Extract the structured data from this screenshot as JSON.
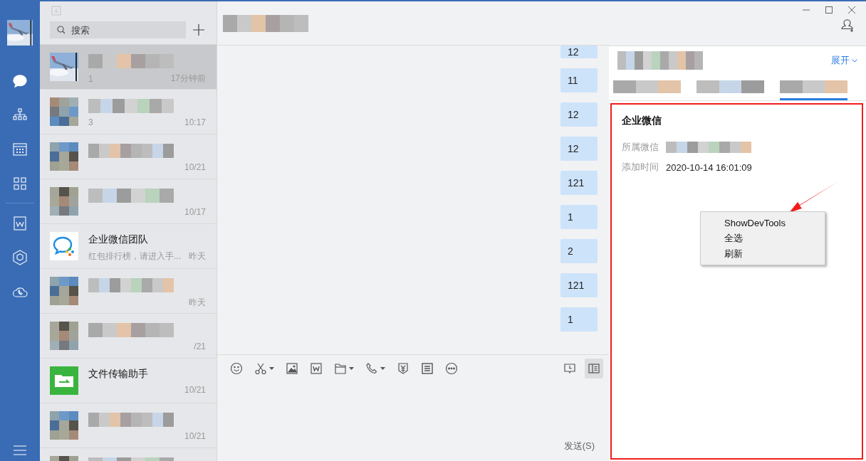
{
  "sidebar": {
    "nav_items": [
      {
        "kind": "chat",
        "selected": true
      },
      {
        "kind": "org",
        "selected": false
      },
      {
        "kind": "calendar",
        "selected": false
      },
      {
        "kind": "apps",
        "selected": false
      },
      {
        "kind": "doc",
        "selected": false
      },
      {
        "kind": "cube",
        "selected": false
      },
      {
        "kind": "cloud",
        "selected": false
      }
    ]
  },
  "chat_list": {
    "search": {
      "placeholder": "搜索"
    },
    "chats": [
      {
        "preview": "1",
        "time": "17分钟前",
        "selected": true
      },
      {
        "kind": "mosaic",
        "preview": "3",
        "time": "10:17",
        "selected": false
      },
      {
        "kind": "mosaic",
        "time": "10/21",
        "selected": false
      },
      {
        "kind": "mosaic",
        "time": "10/17",
        "selected": false
      },
      {
        "kind": "wecom",
        "name": "企业微信团队",
        "preview": "红包排行榜，请进入手...",
        "time": "昨天",
        "selected": false
      },
      {
        "kind": "mosaic",
        "time": "昨天",
        "selected": false
      },
      {
        "kind": "mosaic",
        "time": "/21",
        "selected": false
      },
      {
        "kind": "file",
        "name": "文件传输助手",
        "time": "10/21",
        "selected": false
      },
      {
        "kind": "mosaic",
        "time": "10/21",
        "selected": false
      },
      {
        "kind": "mosaic",
        "selected": false
      }
    ]
  },
  "conversation": {
    "messages": [
      "12",
      "11",
      "12",
      "12",
      "121",
      "1",
      "2",
      "121",
      "1"
    ],
    "input_toolbar": {
      "side_panel_selected": true
    },
    "send_button": "发送(S)"
  },
  "detail_panel": {
    "expand_link": "展开",
    "tabs": [
      {
        "selected": false
      },
      {
        "selected": false
      },
      {
        "selected": true
      }
    ],
    "card": {
      "title": "企业微信",
      "rows": [
        {
          "label": "所属微信"
        },
        {
          "label": "添加时间",
          "value": "2020-10-14 16:01:09"
        }
      ]
    },
    "context_menu": [
      "ShowDevTools",
      "全选",
      "刷新"
    ]
  }
}
